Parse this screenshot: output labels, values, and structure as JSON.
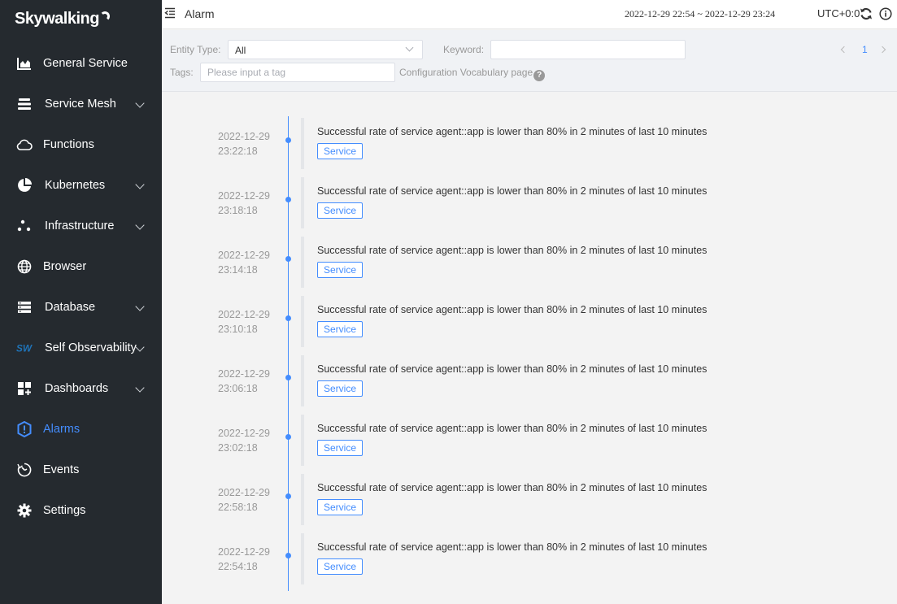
{
  "app": {
    "logo_text": "Skywalking"
  },
  "sidebar": {
    "items": [
      {
        "label": "General Service",
        "icon": "chart-icon",
        "submenu": false
      },
      {
        "label": "Service Mesh",
        "icon": "mesh-icon",
        "submenu": true
      },
      {
        "label": "Functions",
        "icon": "cloud-icon",
        "submenu": false
      },
      {
        "label": "Kubernetes",
        "icon": "pie-icon",
        "submenu": true
      },
      {
        "label": "Infrastructure",
        "icon": "nodes-icon",
        "submenu": true
      },
      {
        "label": "Browser",
        "icon": "globe-icon",
        "submenu": false
      },
      {
        "label": "Database",
        "icon": "database-icon",
        "submenu": true
      },
      {
        "label": "Self Observability",
        "icon": "sw-icon",
        "submenu": true
      },
      {
        "label": "Dashboards",
        "icon": "dashboard-icon",
        "submenu": true
      },
      {
        "label": "Alarms",
        "icon": "alarm-icon",
        "submenu": false,
        "active": true
      },
      {
        "label": "Events",
        "icon": "events-icon",
        "submenu": false
      },
      {
        "label": "Settings",
        "icon": "gear-icon",
        "submenu": false
      }
    ]
  },
  "header": {
    "title": "Alarm",
    "time_range": "2022-12-29 22:54 ~ 2022-12-29 23:24",
    "timezone": "UTC+0:0"
  },
  "filters": {
    "entity_type_label": "Entity Type:",
    "entity_type_value": "All",
    "keyword_label": "Keyword:",
    "keyword_value": "",
    "tags_label": "Tags:",
    "tags_placeholder": "Please input a tag",
    "vocabulary_link": "Configuration Vocabulary page",
    "help_glyph": "?"
  },
  "pagination": {
    "current_page": "1"
  },
  "alarms": [
    {
      "date": "2022-12-29",
      "time": "23:22:18",
      "message": "Successful rate of service agent::app is lower than 80% in 2 minutes of last 10 minutes",
      "scope": "Service"
    },
    {
      "date": "2022-12-29",
      "time": "23:18:18",
      "message": "Successful rate of service agent::app is lower than 80% in 2 minutes of last 10 minutes",
      "scope": "Service"
    },
    {
      "date": "2022-12-29",
      "time": "23:14:18",
      "message": "Successful rate of service agent::app is lower than 80% in 2 minutes of last 10 minutes",
      "scope": "Service"
    },
    {
      "date": "2022-12-29",
      "time": "23:10:18",
      "message": "Successful rate of service agent::app is lower than 80% in 2 minutes of last 10 minutes",
      "scope": "Service"
    },
    {
      "date": "2022-12-29",
      "time": "23:06:18",
      "message": "Successful rate of service agent::app is lower than 80% in 2 minutes of last 10 minutes",
      "scope": "Service"
    },
    {
      "date": "2022-12-29",
      "time": "23:02:18",
      "message": "Successful rate of service agent::app is lower than 80% in 2 minutes of last 10 minutes",
      "scope": "Service"
    },
    {
      "date": "2022-12-29",
      "time": "22:58:18",
      "message": "Successful rate of service agent::app is lower than 80% in 2 minutes of last 10 minutes",
      "scope": "Service"
    },
    {
      "date": "2022-12-29",
      "time": "22:54:18",
      "message": "Successful rate of service agent::app is lower than 80% in 2 minutes of last 10 minutes",
      "scope": "Service"
    }
  ],
  "colors": {
    "accent": "#448dfe",
    "sidebar_bg": "#252a2f"
  }
}
